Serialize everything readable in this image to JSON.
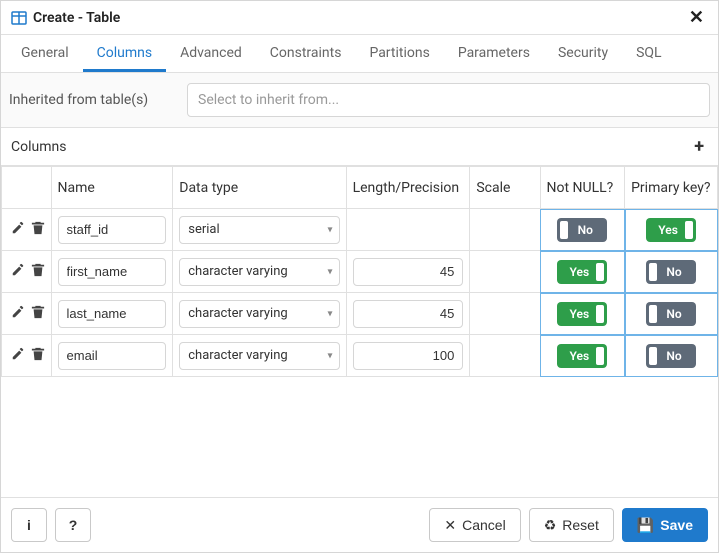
{
  "title": "Create - Table",
  "tabs": [
    "General",
    "Columns",
    "Advanced",
    "Constraints",
    "Partitions",
    "Parameters",
    "Security",
    "SQL"
  ],
  "active_tab": "Columns",
  "inherit": {
    "label": "Inherited from table(s)",
    "placeholder": "Select to inherit from..."
  },
  "grid": {
    "title": "Columns",
    "headers": {
      "name": "Name",
      "datatype": "Data type",
      "length": "Length/Precision",
      "scale": "Scale",
      "notnull": "Not NULL?",
      "pk": "Primary key?"
    },
    "toggle_labels": {
      "yes": "Yes",
      "no": "No"
    },
    "rows": [
      {
        "name": "staff_id",
        "datatype": "serial",
        "length": "",
        "scale": "",
        "notnull": false,
        "pk": true
      },
      {
        "name": "first_name",
        "datatype": "character varying",
        "length": "45",
        "scale": "",
        "notnull": true,
        "pk": false
      },
      {
        "name": "last_name",
        "datatype": "character varying",
        "length": "45",
        "scale": "",
        "notnull": true,
        "pk": false
      },
      {
        "name": "email",
        "datatype": "character varying",
        "length": "100",
        "scale": "",
        "notnull": true,
        "pk": false
      }
    ]
  },
  "footer": {
    "info": "i",
    "help": "?",
    "cancel": "Cancel",
    "reset": "Reset",
    "save": "Save"
  },
  "icons": {
    "close": "✕",
    "plus": "+",
    "caret": "▾",
    "cancel": "✕",
    "reset": "♻",
    "save": "💾"
  }
}
